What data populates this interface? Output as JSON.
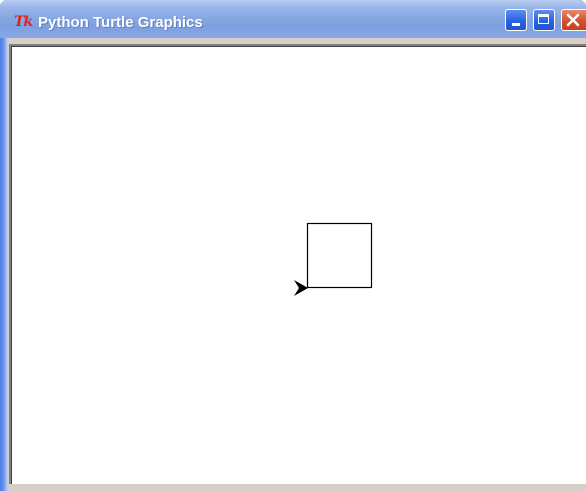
{
  "window": {
    "title": "Python Turtle Graphics",
    "app_icon": "Tk",
    "controls": {
      "minimize": "minimize-icon",
      "maximize": "maximize-icon",
      "close": "close-icon"
    }
  },
  "turtle": {
    "shape": "arrow-cursor",
    "heading": "east",
    "color": "#000000"
  },
  "drawing": {
    "shape": "square",
    "stroke_color": "#000000",
    "fill": "none"
  },
  "colors": {
    "titlebar": "#88a8e3",
    "frame": "#4a7ee8",
    "canvas": "#ffffff"
  }
}
